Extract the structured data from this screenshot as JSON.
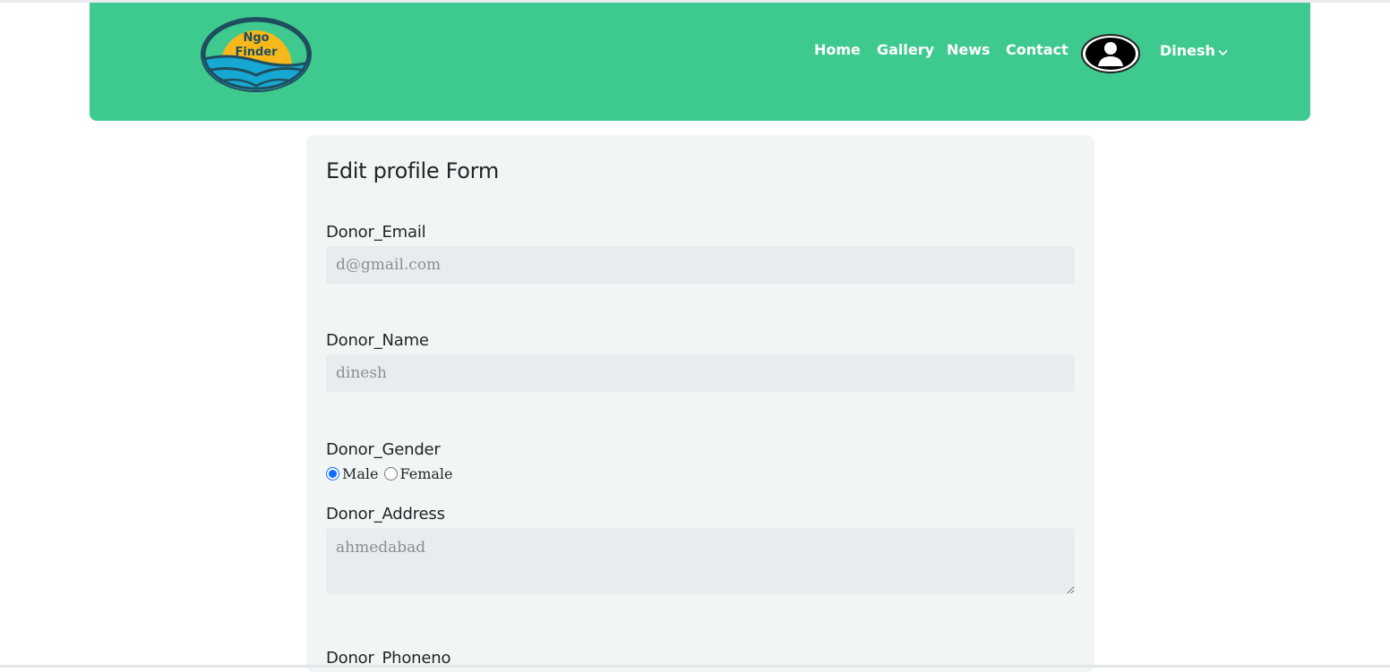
{
  "logo": {
    "line1": "Ngo",
    "line2": "Finder"
  },
  "nav": {
    "home": "Home",
    "gallery": "Gallery",
    "news": "News",
    "contact": "Contact",
    "user_name": "Dinesh"
  },
  "form": {
    "title": "Edit profile Form",
    "email": {
      "label": "Donor_Email",
      "placeholder": "d@gmail.com"
    },
    "name": {
      "label": "Donor_Name",
      "placeholder": "dinesh"
    },
    "gender": {
      "label": "Donor_Gender",
      "options": [
        "Male",
        "Female"
      ],
      "selected": "Male"
    },
    "address": {
      "label": "Donor_Address",
      "placeholder": "ahmedabad"
    },
    "phone": {
      "label": "Donor_Phoneno"
    }
  },
  "colors": {
    "header_bg": "#3ec98f",
    "card_bg": "#f2f5f5",
    "field_bg": "#e7ecee",
    "logo_yellow": "#f6b81b",
    "logo_blue": "#17a7d3",
    "logo_ring": "#1f4e5e"
  }
}
